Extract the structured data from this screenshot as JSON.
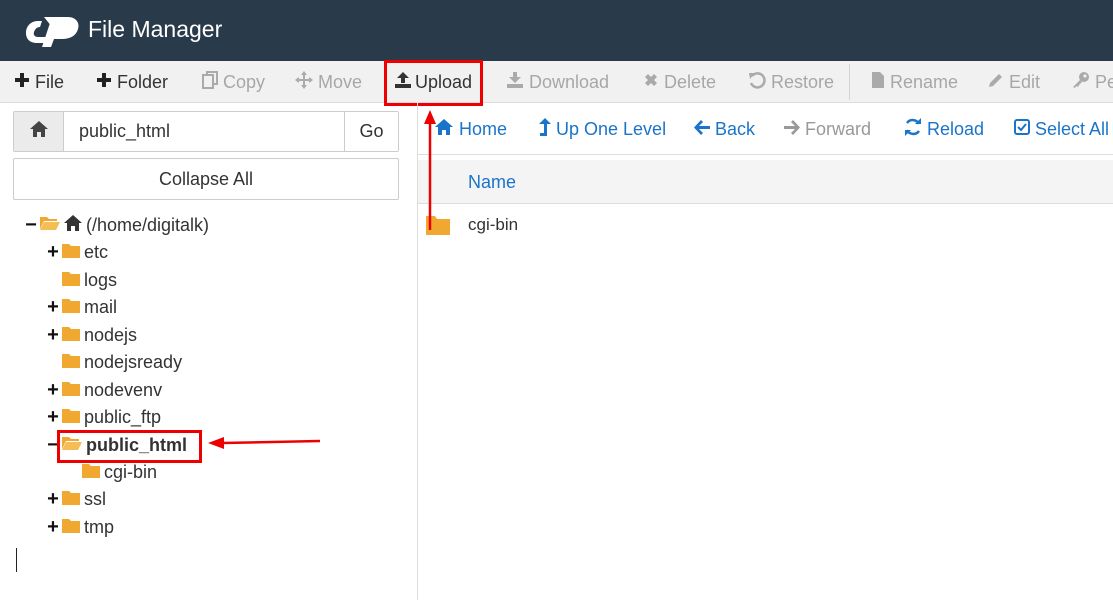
{
  "header": {
    "title": "File Manager",
    "logo_icon": "cpanel-logo-icon"
  },
  "toolbar": {
    "items": [
      {
        "label": "File",
        "icon": "plus-icon",
        "enabled": true
      },
      {
        "label": "Folder",
        "icon": "plus-icon",
        "enabled": true
      },
      {
        "label": "Copy",
        "icon": "copy-icon",
        "enabled": false
      },
      {
        "label": "Move",
        "icon": "move-icon",
        "enabled": false
      },
      {
        "label": "Upload",
        "icon": "upload-icon",
        "enabled": true
      },
      {
        "label": "Download",
        "icon": "download-icon",
        "enabled": false
      },
      {
        "label": "Delete",
        "icon": "times-icon",
        "enabled": false
      },
      {
        "label": "Restore",
        "icon": "undo-icon",
        "enabled": false
      },
      {
        "label": "Rename",
        "icon": "file-icon",
        "enabled": false
      },
      {
        "label": "Edit",
        "icon": "pencil-icon",
        "enabled": false
      },
      {
        "label": "Pe",
        "icon": "key-icon",
        "enabled": false
      }
    ]
  },
  "path_bar": {
    "value": "public_html",
    "go_label": "Go"
  },
  "collapse_all_label": "Collapse All",
  "tree": {
    "root_label": "(/home/digitalk)",
    "items": [
      {
        "label": "etc",
        "toggle": "+"
      },
      {
        "label": "logs",
        "toggle": ""
      },
      {
        "label": "mail",
        "toggle": "+"
      },
      {
        "label": "nodejs",
        "toggle": "+"
      },
      {
        "label": "nodejsready",
        "toggle": ""
      },
      {
        "label": "nodevenv",
        "toggle": "+"
      },
      {
        "label": "public_ftp",
        "toggle": "+"
      },
      {
        "label": "public_html",
        "toggle": "−",
        "selected": true
      },
      {
        "label": "cgi-bin",
        "toggle": "",
        "child": true
      },
      {
        "label": "ssl",
        "toggle": "+"
      },
      {
        "label": "tmp",
        "toggle": "+"
      }
    ]
  },
  "nav": {
    "home": "Home",
    "up_one_level": "Up One Level",
    "back": "Back",
    "forward": "Forward",
    "reload": "Reload",
    "select_all": "Select All"
  },
  "file_list": {
    "column_name": "Name",
    "rows": [
      {
        "name": "cgi-bin",
        "type": "folder"
      }
    ]
  },
  "colors": {
    "header_bg": "#293a4a",
    "link_blue": "#1a74c9",
    "folder_orange": "#f0a830",
    "highlight_red": "#e00000"
  }
}
